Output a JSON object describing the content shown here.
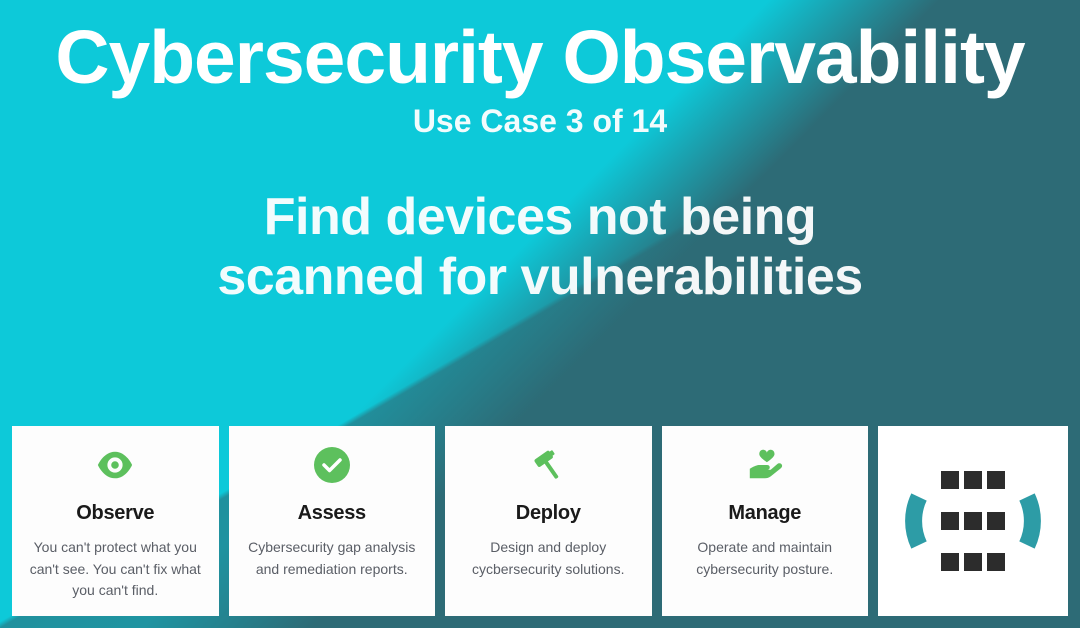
{
  "colors": {
    "accent_green": "#5dc05d",
    "icon_dark": "#2c2c2c",
    "logo_teal": "#2d9ca6"
  },
  "hero": {
    "title": "Cybersecurity Observability",
    "subtitle": "Use Case 3 of 14",
    "heading_line1": "Find devices not being",
    "heading_line2": "scanned for vulnerabilities"
  },
  "cards": [
    {
      "icon": "eye-icon",
      "title": "Observe",
      "desc": "You can't protect what you can't see. You can't fix what you can't find."
    },
    {
      "icon": "check-circle-icon",
      "title": "Assess",
      "desc": "Cybersecurity gap analysis and remediation reports."
    },
    {
      "icon": "hammer-icon",
      "title": "Deploy",
      "desc": "Design and deploy cycbersecurity solutions."
    },
    {
      "icon": "hand-heart-icon",
      "title": "Manage",
      "desc": "Operate and maintain cybersecurity posture."
    }
  ]
}
